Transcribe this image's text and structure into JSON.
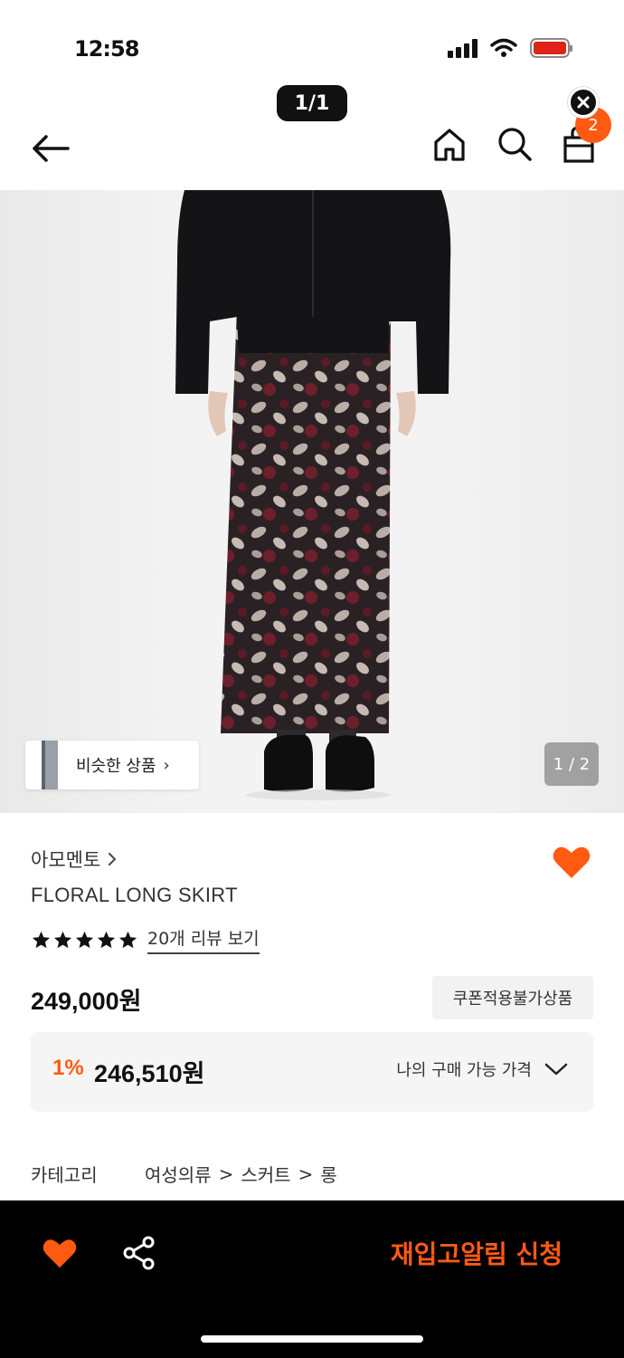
{
  "status_bar": {
    "time": "12:58"
  },
  "header": {
    "page_counter": "1/1",
    "cart_count": "2"
  },
  "gallery": {
    "similar_label": "비슷한 상품",
    "image_counter": "1 / 2"
  },
  "product": {
    "brand": "아모멘토",
    "name": "FLORAL LONG SKIRT",
    "rating_stars": 5,
    "review_link": "20개 리뷰 보기",
    "price": "249,000원",
    "coupon_badge": "쿠폰적용불가상품",
    "discount_rate": "1%",
    "discount_price": "246,510원",
    "my_price_label": "나의 구매 가능 가격"
  },
  "category": {
    "label": "카테고리",
    "path": [
      "여성의류",
      "스커트",
      "롱"
    ]
  },
  "bottom_bar": {
    "restock_label": "재입고알림 신청"
  },
  "colors": {
    "accent": "#ff5a12",
    "bottom_bar": "#000000"
  },
  "icons": [
    "back-arrow-icon",
    "home-icon",
    "search-icon",
    "shopping-bag-icon",
    "close-icon",
    "heart-icon",
    "share-icon",
    "chevron-down-icon",
    "chevron-right-icon",
    "star-icon"
  ]
}
